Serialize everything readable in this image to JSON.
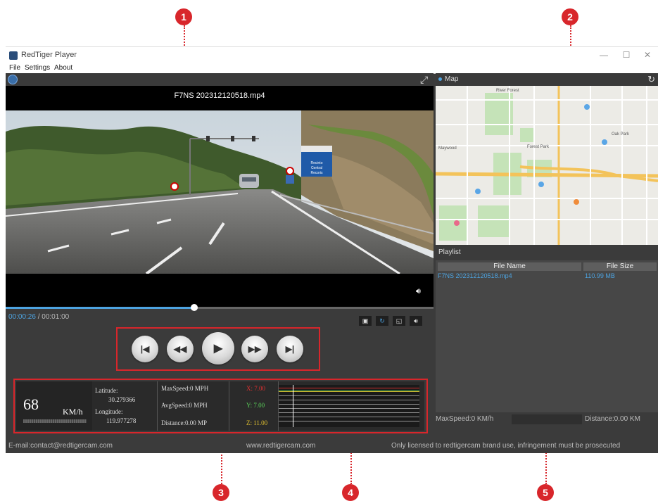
{
  "annotations": [
    "1",
    "2",
    "3",
    "4",
    "5"
  ],
  "window": {
    "title": "RedTiger Player",
    "menu": [
      "File",
      "Settings",
      "About"
    ],
    "controls": {
      "minimize": "—",
      "maximize": "☐",
      "close": "✕"
    }
  },
  "video": {
    "filename": "F7NS 202312120518.mp4",
    "current_time": "00:00:26",
    "separator": " / ",
    "total_time": "00:01:00",
    "progress": 0.44,
    "signs": {
      "sign_a": "Recinto",
      "sign_b": "Central",
      "sign_c": "Recoris"
    }
  },
  "player_icons": [
    "fullscreen-icon",
    "volume-icon",
    "snapshot-icon",
    "loop-icon",
    "zoom-icon",
    "volume-icon"
  ],
  "controls": [
    "previous-button",
    "rewind-button",
    "play-button",
    "fast-forward-button",
    "next-button"
  ],
  "telemetry": {
    "speed": "68",
    "speed_unit": "KM/h",
    "latitude_label": "Latitude:",
    "latitude": "30.279366",
    "longitude_label": "Longitude:",
    "longitude": "119.977278",
    "max_speed": "MaxSpeed:0 MPH",
    "avg_speed": "AvgSpeed:0 MPH",
    "distance": "Distance:0.00 MP",
    "gsensor_x": "X: 7.00",
    "gsensor_y": "Y: 7.00",
    "gsensor_z": "Z: 11.00"
  },
  "colors": {
    "accent": "#4da3e0",
    "annotation": "#d8262b",
    "x_axis": "#e03030",
    "y_axis": "#5ad25a",
    "z_axis": "#e0c030"
  },
  "footer": {
    "email": "E-mail:contact@redtigercam.com",
    "website": "www.redtigercam.com",
    "license": "Only licensed to redtigercam brand use, infringement must be prosecuted"
  },
  "map": {
    "label": "Map",
    "places": [
      "River Forest",
      "Oak Park",
      "Forest Park",
      "Maywood"
    ]
  },
  "playlist": {
    "title": "Playlist",
    "columns": [
      "File Name",
      "File Size"
    ],
    "rows": [
      {
        "name": "F7NS 202312120518.mp4",
        "size": "110.99 MB"
      }
    ],
    "max_speed": "MaxSpeed:0 KM/h",
    "distance": "Distance:0.00 KM"
  }
}
